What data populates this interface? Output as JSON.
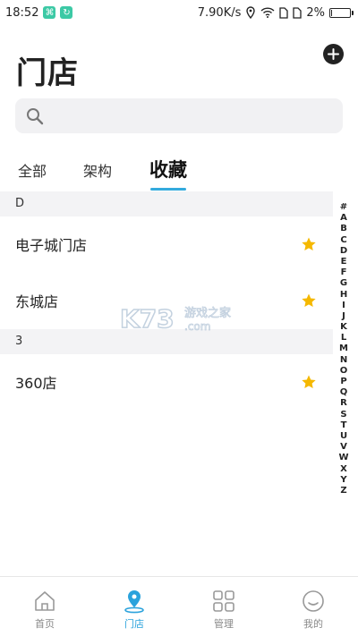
{
  "statusbar": {
    "time": "18:52",
    "speed": "7.90K/s",
    "battery": "2%",
    "battery_level": 0.02
  },
  "header": {
    "title": "门店"
  },
  "search": {
    "placeholder": ""
  },
  "tabs": [
    {
      "label": "全部"
    },
    {
      "label": "架构"
    },
    {
      "label": "收藏",
      "active": true
    }
  ],
  "sections": [
    {
      "letter": "D",
      "items": [
        {
          "name": "电子城门店"
        },
        {
          "name": "东城店"
        }
      ]
    },
    {
      "letter": "3",
      "items": [
        {
          "name": "360店"
        }
      ]
    }
  ],
  "index_letters": [
    "#",
    "A",
    "B",
    "C",
    "D",
    "E",
    "F",
    "G",
    "H",
    "I",
    "J",
    "K",
    "L",
    "M",
    "N",
    "O",
    "P",
    "Q",
    "R",
    "S",
    "T",
    "U",
    "V",
    "W",
    "X",
    "Y",
    "Z"
  ],
  "watermark": {
    "logo": "K73",
    "text": "游戏之家",
    "domain": ".com"
  },
  "nav": [
    {
      "label": "首页",
      "icon": "home-icon"
    },
    {
      "label": "门店",
      "icon": "location-pin-icon",
      "active": true
    },
    {
      "label": "管理",
      "icon": "grid-icon"
    },
    {
      "label": "我的",
      "icon": "smiley-icon"
    }
  ],
  "colors": {
    "accent": "#2aa2dc",
    "star": "#f5b800",
    "section_bg": "#f3f3f5",
    "search_bg": "#f1f1f3"
  }
}
